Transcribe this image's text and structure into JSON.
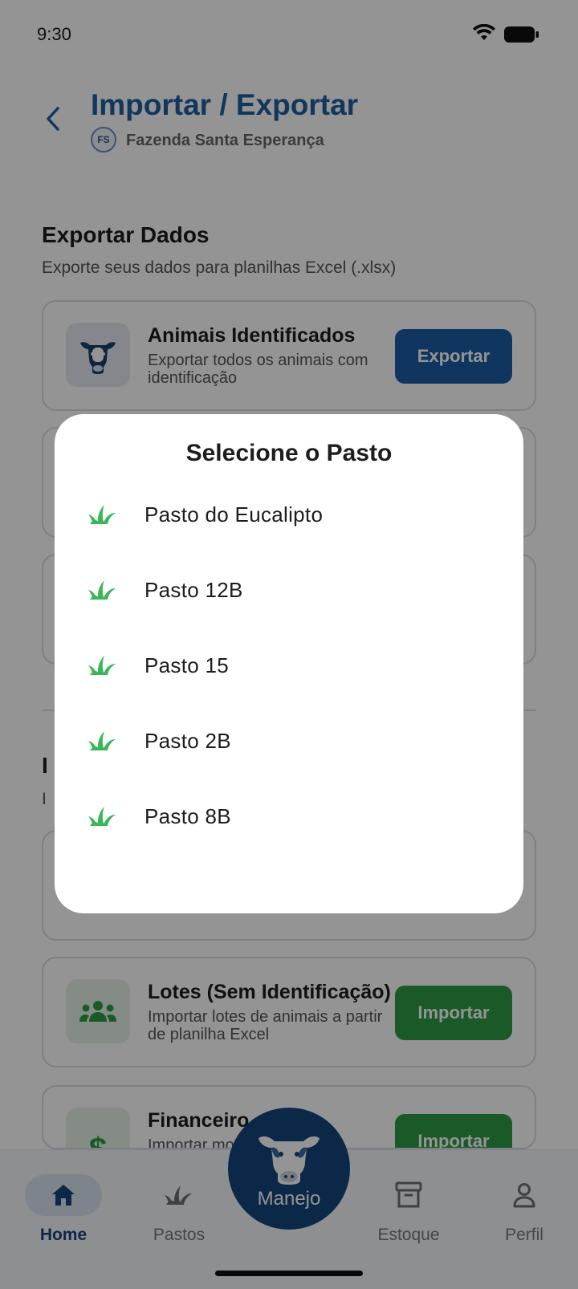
{
  "status_bar": {
    "time": "9:30"
  },
  "header": {
    "title": "Importar / Exportar",
    "farm_initials": "FS",
    "farm_name": "Fazenda Santa Esperança"
  },
  "export_section": {
    "title": "Exportar Dados",
    "subtitle": "Exporte seus dados para planilhas Excel (.xlsx)",
    "cards": [
      {
        "title": "Animais Identificados",
        "description": "Exportar todos os animais com identificação",
        "button": "Exportar",
        "icon": "cow-icon"
      }
    ]
  },
  "import_section": {
    "title_visible": "I",
    "subtitle_visible": "I",
    "cards": [
      {
        "title": "Lotes (Sem Identificação)",
        "description": "Importar lotes de animais a partir de planilha Excel",
        "button": "Importar",
        "icon": "group-icon"
      },
      {
        "title": "Financeiro",
        "description": "Importar mov",
        "button": "Importar",
        "icon": "dollar-icon"
      }
    ]
  },
  "modal": {
    "title": "Selecione o Pasto",
    "pastures": [
      {
        "label": "Pasto do Eucalipto",
        "icon": "grass-icon"
      },
      {
        "label": "Pasto 12B",
        "icon": "grass-icon"
      },
      {
        "label": "Pasto 15",
        "icon": "grass-icon"
      },
      {
        "label": "Pasto 2B",
        "icon": "grass-icon"
      },
      {
        "label": "Pasto 8B",
        "icon": "grass-icon"
      }
    ]
  },
  "bottom_nav": {
    "home": "Home",
    "pastos": "Pastos",
    "manejo": "Manejo",
    "estoque": "Estoque",
    "perfil": "Perfil"
  },
  "colors": {
    "primary_blue": "#1c5da6",
    "title_blue": "#1f5fa0",
    "import_green": "#2e9b48",
    "grass_green": "#3cb55a",
    "nav_dark": "#16457d"
  }
}
